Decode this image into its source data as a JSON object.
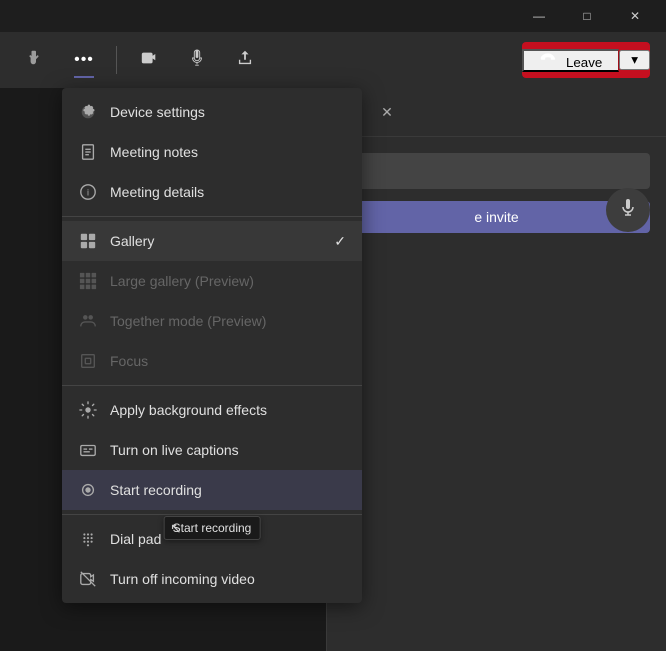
{
  "titleBar": {
    "minimizeLabel": "—",
    "maximizeLabel": "□",
    "closeLabel": "✕"
  },
  "toolbar": {
    "handBtn": "✋",
    "moreBtn": "•••",
    "videoBtn": "📷",
    "micBtn": "🎙",
    "shareBtn": "⬆",
    "leaveLabel": "Leave",
    "leaveArrow": "▾"
  },
  "sidePanel": {
    "moreIcon": "•••",
    "closeIcon": "✕",
    "invitePlaceholder": "",
    "copyInviteLabel": "e invite",
    "micIcon": "🎙"
  },
  "menu": {
    "items": [
      {
        "id": "device-settings",
        "icon": "⚙",
        "label": "Device settings",
        "disabled": false,
        "selected": false
      },
      {
        "id": "meeting-notes",
        "icon": "📋",
        "label": "Meeting notes",
        "disabled": false,
        "selected": false
      },
      {
        "id": "meeting-details",
        "icon": "ℹ",
        "label": "Meeting details",
        "disabled": false,
        "selected": false
      },
      {
        "divider": true
      },
      {
        "id": "gallery",
        "icon": "⊞",
        "label": "Gallery",
        "disabled": false,
        "selected": true,
        "checkmark": "✓"
      },
      {
        "id": "large-gallery",
        "icon": "⊟",
        "label": "Large gallery (Preview)",
        "disabled": true,
        "selected": false
      },
      {
        "id": "together-mode",
        "icon": "👥",
        "label": "Together mode (Preview)",
        "disabled": true,
        "selected": false
      },
      {
        "id": "focus",
        "icon": "⊡",
        "label": "Focus",
        "disabled": true,
        "selected": false
      },
      {
        "divider": true
      },
      {
        "id": "background-effects",
        "icon": "✨",
        "label": "Apply background effects",
        "disabled": false,
        "selected": false
      },
      {
        "id": "live-captions",
        "icon": "💬",
        "label": "Turn on live captions",
        "disabled": false,
        "selected": false
      },
      {
        "id": "start-recording",
        "icon": "⏺",
        "label": "Start recording",
        "disabled": false,
        "selected": false,
        "hasTooltip": true,
        "tooltipLabel": "Start recording"
      },
      {
        "divider": true
      },
      {
        "id": "dial-pad",
        "icon": "⌨",
        "label": "Dial pad",
        "disabled": false,
        "selected": false
      },
      {
        "id": "turn-off-video",
        "icon": "📵",
        "label": "Turn off incoming video",
        "disabled": false,
        "selected": false
      }
    ]
  },
  "colors": {
    "accent": "#6264a7",
    "danger": "#c50f1f",
    "menuBg": "#2d2d2d",
    "hoverBg": "#383838",
    "disabledText": "#666666"
  }
}
